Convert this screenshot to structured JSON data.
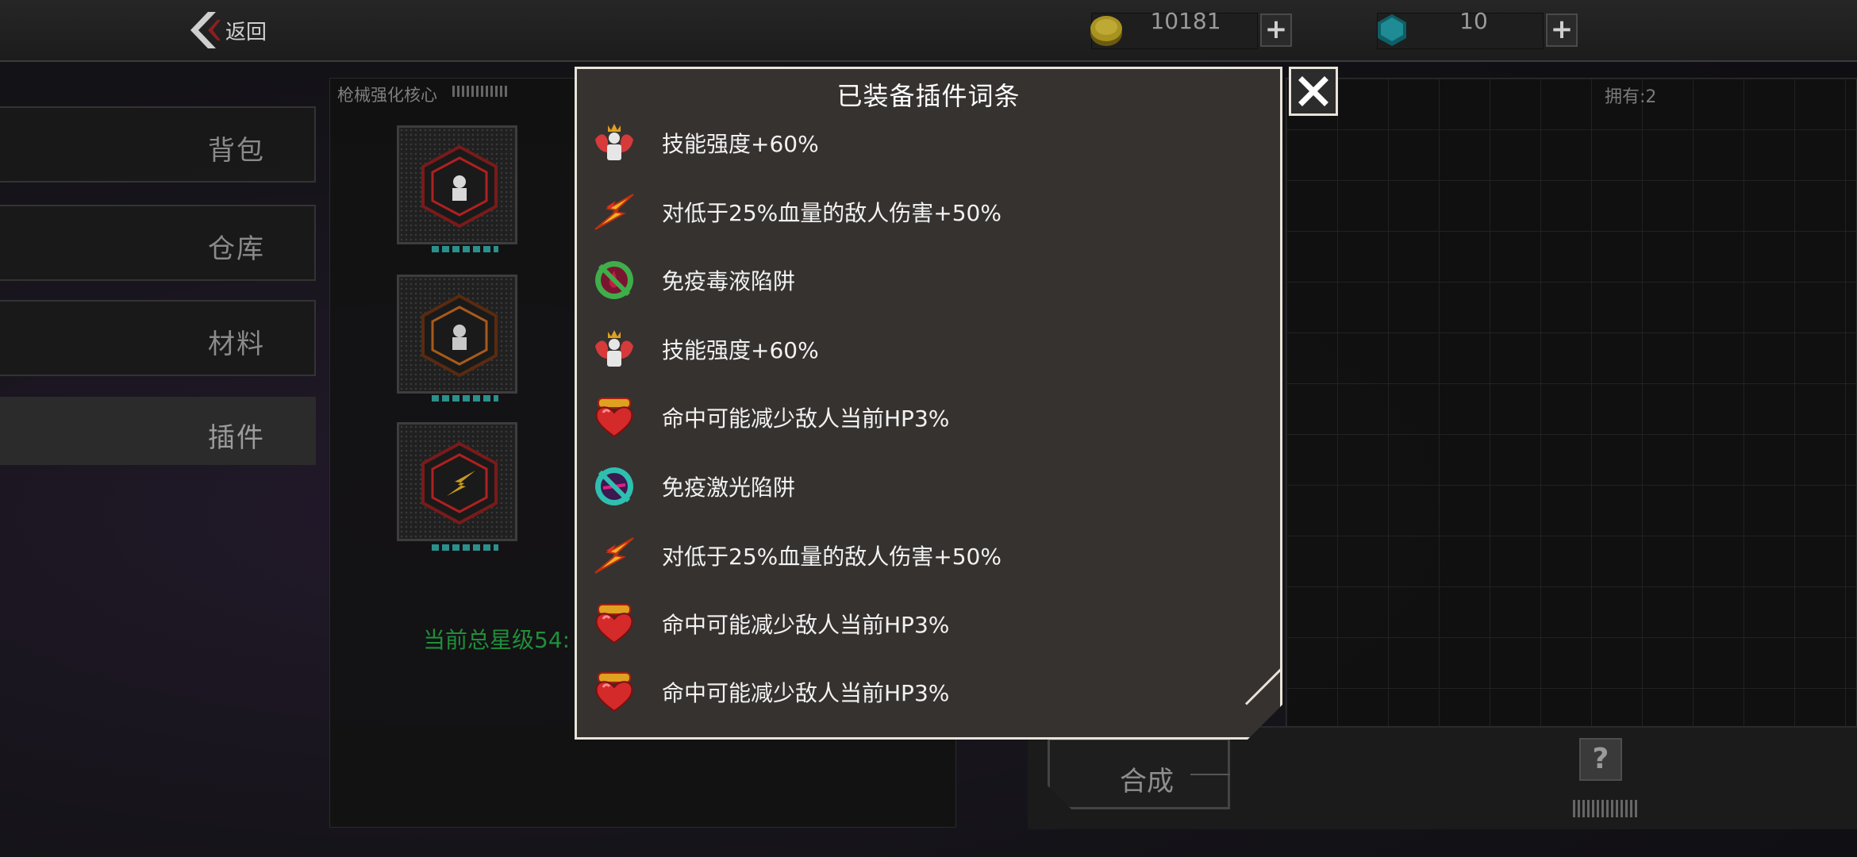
{
  "header": {
    "back_label": "返回",
    "gold": {
      "value": "10181",
      "add_label": "+"
    },
    "gem": {
      "value": "10",
      "add_label": "+"
    }
  },
  "sidebar": {
    "tabs": [
      {
        "label": "背包",
        "active": false
      },
      {
        "label": "仓库",
        "active": false
      },
      {
        "label": "材料",
        "active": false
      },
      {
        "label": "插件",
        "active": true
      }
    ]
  },
  "core_panel": {
    "title": "枪械强化核心",
    "star_total": "当前总星级54:"
  },
  "right_panel": {
    "owned": "拥有:2",
    "synth_label": "合成",
    "help_label": "?"
  },
  "modal": {
    "title": "已装备插件词条",
    "entries": [
      {
        "icon": "skill-angel-icon",
        "text": "技能强度+60%"
      },
      {
        "icon": "lightning-strike-icon",
        "text": "对低于25%血量的敌人伤害+50%"
      },
      {
        "icon": "poison-immune-icon",
        "text": "免疫毒液陷阱"
      },
      {
        "icon": "skill-angel-icon",
        "text": "技能强度+60%"
      },
      {
        "icon": "heart-bullet-icon",
        "text": "命中可能减少敌人当前HP3%"
      },
      {
        "icon": "laser-immune-icon",
        "text": "免疫激光陷阱"
      },
      {
        "icon": "lightning-strike-icon",
        "text": "对低于25%血量的敌人伤害+50%"
      },
      {
        "icon": "heart-bullet-icon",
        "text": "命中可能减少敌人当前HP3%"
      },
      {
        "icon": "heart-bullet-icon",
        "text": "命中可能减少敌人当前HP3%"
      }
    ]
  },
  "colors": {
    "modal_bg": "#363230",
    "modal_border": "#e8e3d8",
    "star_total": "#1f8f3a",
    "slot_accent": "#2b8f8c"
  }
}
